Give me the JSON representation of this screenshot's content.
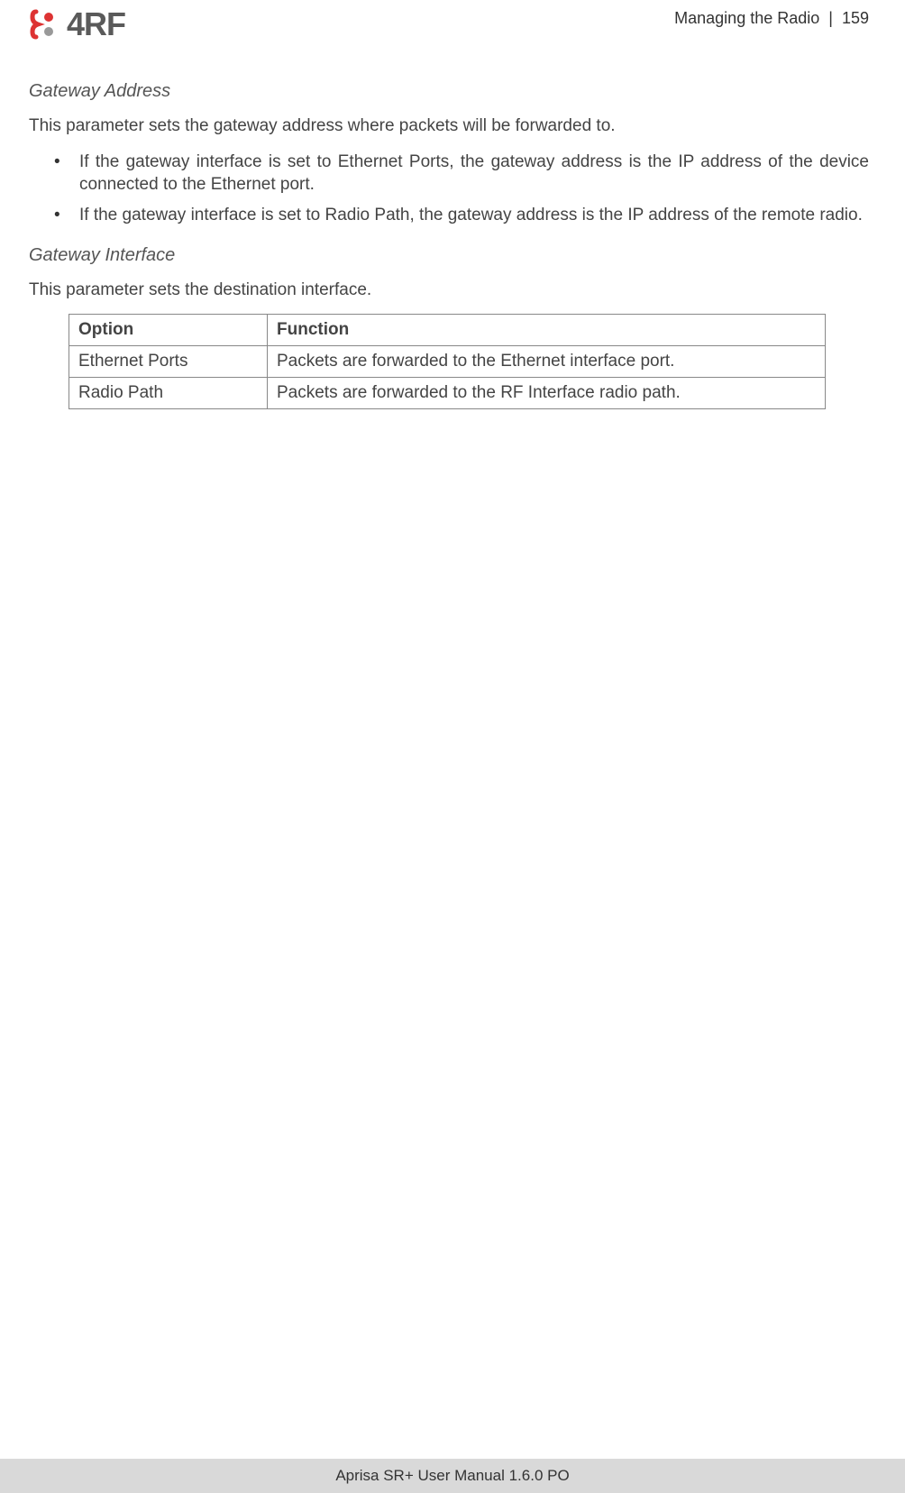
{
  "header": {
    "logo_text": "4RF",
    "section_title": "Managing the Radio",
    "page_number": "159"
  },
  "sections": [
    {
      "heading": "Gateway Address",
      "intro": "This parameter sets the gateway address where packets will be forwarded to.",
      "bullets": [
        "If the gateway interface is set to Ethernet Ports, the gateway address is the IP address of the device connected to the Ethernet port.",
        "If the gateway interface is set to Radio Path, the gateway address is the IP address of the remote radio."
      ]
    },
    {
      "heading": "Gateway Interface",
      "intro": "This parameter sets the destination interface."
    }
  ],
  "table": {
    "headers": [
      "Option",
      "Function"
    ],
    "rows": [
      [
        "Ethernet Ports",
        "Packets are forwarded to the Ethernet interface port."
      ],
      [
        "Radio Path",
        "Packets are forwarded to the RF Interface radio path."
      ]
    ]
  },
  "footer": {
    "text": "Aprisa SR+ User Manual 1.6.0 PO"
  }
}
